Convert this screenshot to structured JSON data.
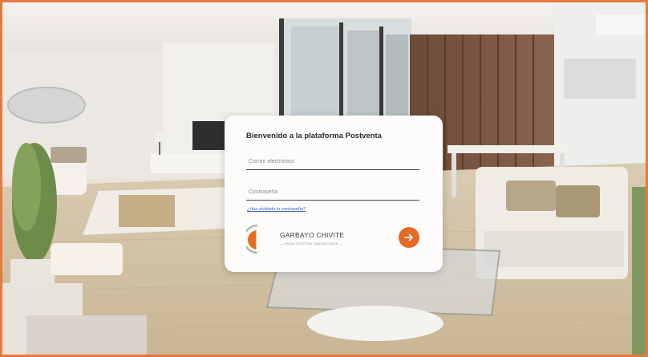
{
  "login": {
    "title": "Bienvenido a la plataforma Postventa",
    "email": {
      "placeholder": "Correo electrónico",
      "value": ""
    },
    "password": {
      "placeholder": "Contraseña",
      "value": ""
    },
    "forgot_link": "¿Has olvidado tu contraseña?",
    "submit_icon": "arrow-right-icon"
  },
  "brand": {
    "name": "GARBAYO CHIVITE",
    "tagline": "— ARQUITECTURA INMOBILIARIA —",
    "logo_icon": "garbayo-chivite-logo-icon",
    "accent_color": "#e46b26"
  },
  "background": {
    "description_icon": "interior-living-room-image"
  }
}
